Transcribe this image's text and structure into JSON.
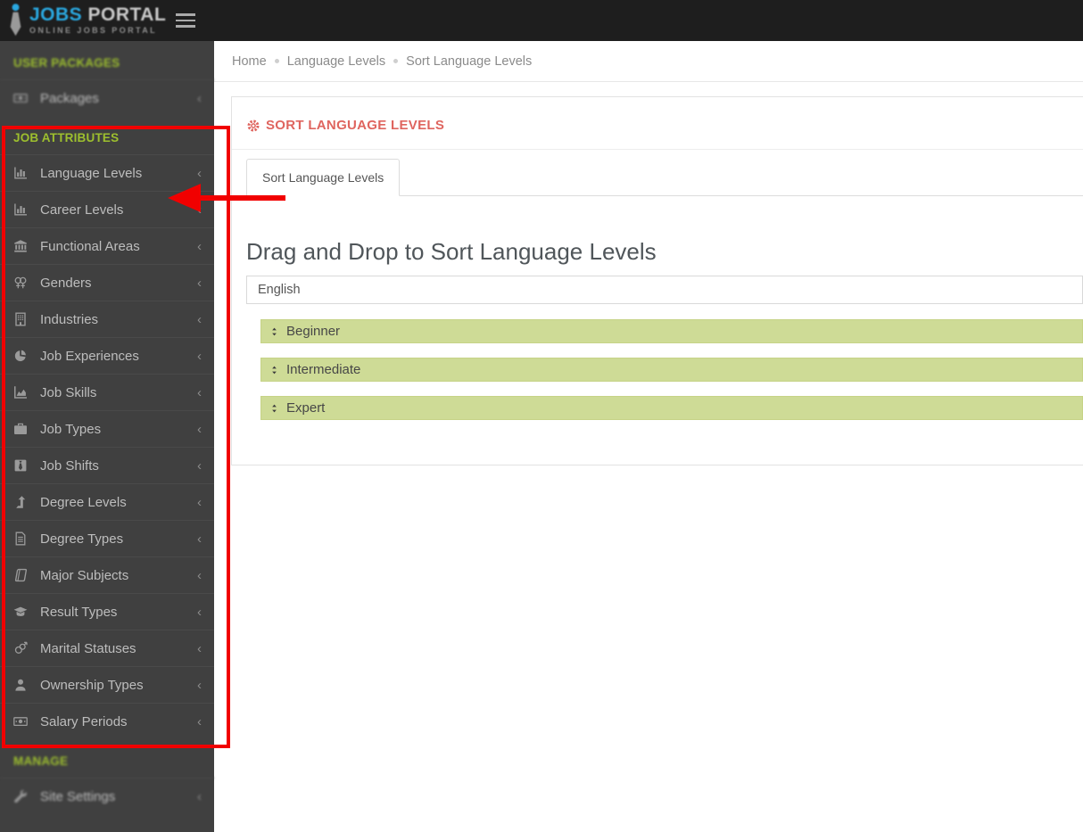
{
  "topbar": {
    "logo": {
      "title_part1": "JOBS",
      "title_part2": "PORTAL",
      "subtitle": "ONLINE JOBS PORTAL"
    }
  },
  "sidebar": {
    "chevron": "‹",
    "sections": [
      {
        "heading": "USER PACKAGES",
        "blurred": true,
        "items": [
          {
            "label": "Packages",
            "icon": "money-icon"
          }
        ]
      },
      {
        "heading": "JOB ATTRIBUTES",
        "blurred": false,
        "items": [
          {
            "label": "Language Levels",
            "icon": "bar-chart-icon"
          },
          {
            "label": "Career Levels",
            "icon": "bar-chart-icon"
          },
          {
            "label": "Functional Areas",
            "icon": "bank-icon"
          },
          {
            "label": "Genders",
            "icon": "venus-double-icon"
          },
          {
            "label": "Industries",
            "icon": "building-icon"
          },
          {
            "label": "Job Experiences",
            "icon": "pie-chart-icon"
          },
          {
            "label": "Job Skills",
            "icon": "area-chart-icon"
          },
          {
            "label": "Job Types",
            "icon": "briefcase-icon"
          },
          {
            "label": "Job Shifts",
            "icon": "tie-icon"
          },
          {
            "label": "Degree Levels",
            "icon": "level-up-icon"
          },
          {
            "label": "Degree Types",
            "icon": "file-text-icon"
          },
          {
            "label": "Major Subjects",
            "icon": "book-icon"
          },
          {
            "label": "Result Types",
            "icon": "graduation-cap-icon"
          },
          {
            "label": "Marital Statuses",
            "icon": "intersex-icon"
          },
          {
            "label": "Ownership Types",
            "icon": "user-icon"
          },
          {
            "label": "Salary Periods",
            "icon": "money-icon"
          }
        ]
      },
      {
        "heading": "MANAGE",
        "blurred": true,
        "items": [
          {
            "label": "Site Settings",
            "icon": "wrench-icon"
          }
        ]
      }
    ]
  },
  "breadcrumb": {
    "items": [
      "Home",
      "Language Levels",
      "Sort Language Levels"
    ]
  },
  "panel": {
    "title": "SORT LANGUAGE LEVELS",
    "title_icon": "gear-icon",
    "tab_label": "Sort Language Levels"
  },
  "content": {
    "heading": "Drag and Drop to Sort Language Levels",
    "group_label": "English",
    "sort_items": [
      "Beginner",
      "Intermediate",
      "Expert"
    ]
  },
  "colors": {
    "annotation_red": "#f10000",
    "title_red": "#df655f",
    "sidebar_heading_green": "#9dbf2e",
    "sort_item_green": "#cedb96",
    "logo_blue": "#2aa8e0"
  }
}
